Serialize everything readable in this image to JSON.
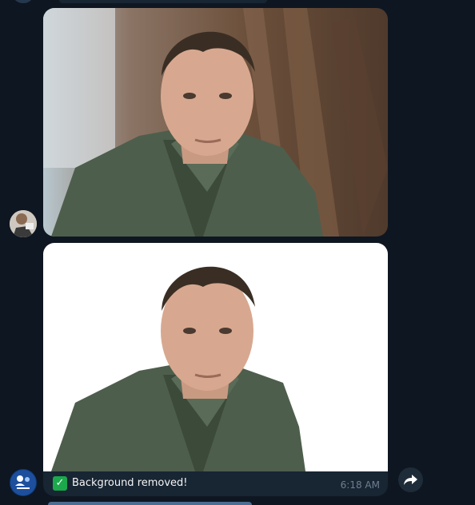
{
  "messages": {
    "bot_reply": {
      "caption": "Background removed!",
      "time": "6:18 AM",
      "status_icon": "check-mark-emoji"
    }
  },
  "icons": {
    "forward": "forward-arrow-icon",
    "bot_avatar": "bot-logo-icon",
    "user_avatar": "user-photo"
  },
  "colors": {
    "background": "#0e1621",
    "bubble": "#182533",
    "time": "#6d7f8f",
    "check": "#1ca84c"
  }
}
